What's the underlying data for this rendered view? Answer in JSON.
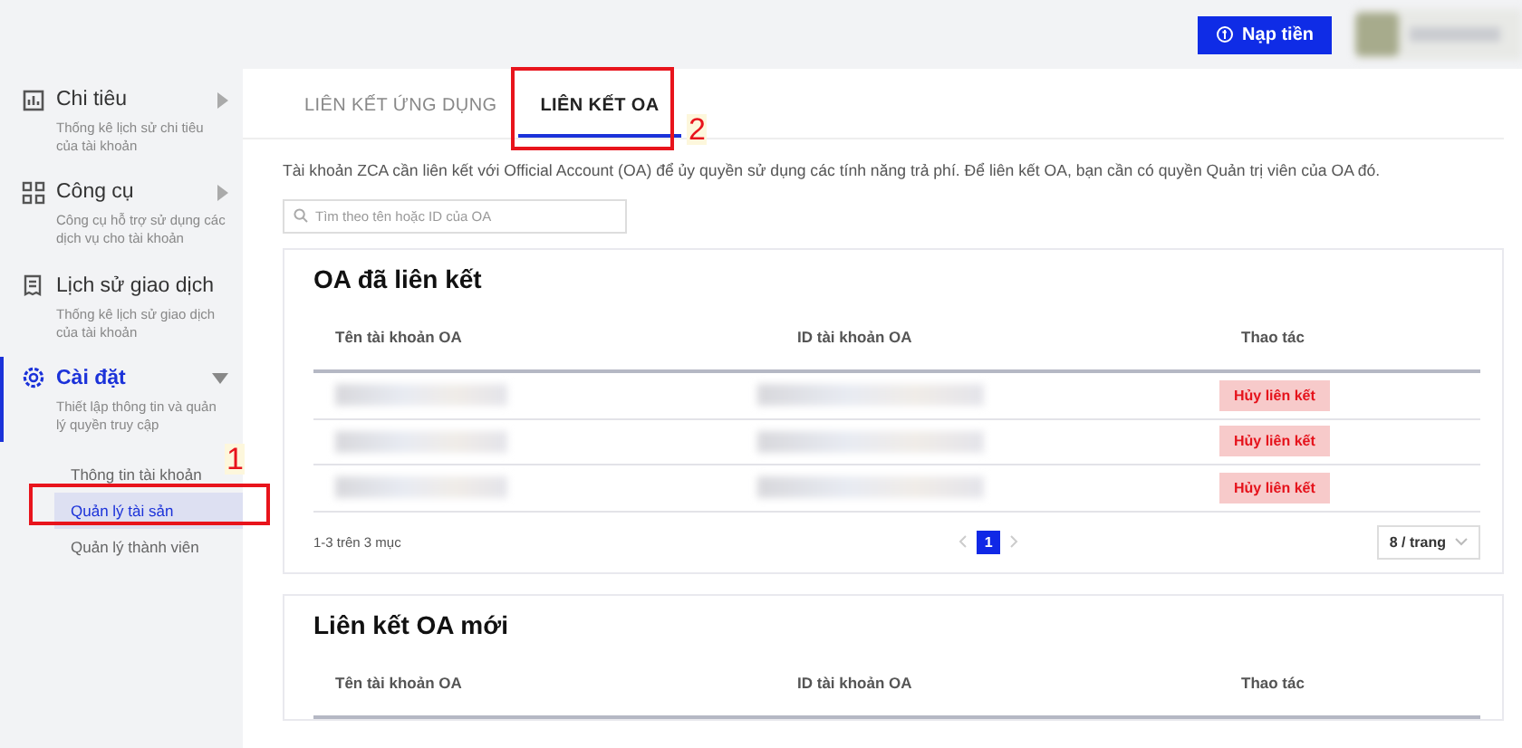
{
  "header": {
    "topup_button": "Nạp tiền"
  },
  "sidebar": {
    "items": [
      {
        "kind": "chart",
        "title": "Chi tiêu",
        "subtitle": "Thống kê lịch sử chi tiêu của tài khoản",
        "expanded": false,
        "selected": false
      },
      {
        "kind": "tools",
        "title": "Công cụ",
        "subtitle": "Công cụ hỗ trợ sử dụng các dịch vụ cho tài khoản",
        "expanded": false,
        "selected": false
      },
      {
        "kind": "history",
        "title": "Lịch sử giao dịch",
        "subtitle": "Thống kê lịch sử giao dịch của tài khoản",
        "selected": false
      },
      {
        "kind": "settings",
        "title": "Cài đặt",
        "subtitle": "Thiết lập thông tin và quản lý quyền truy cập",
        "expanded": true,
        "selected": true,
        "children": [
          {
            "label": "Thông tin tài khoản",
            "selected": false
          },
          {
            "label": "Quản lý tài sản",
            "selected": true
          },
          {
            "label": "Quản lý thành viên",
            "selected": false
          }
        ]
      }
    ]
  },
  "tabs": [
    {
      "label": "LIÊN KẾT ỨNG DỤNG",
      "selected": false
    },
    {
      "label": "LIÊN KẾT OA",
      "selected": true
    }
  ],
  "description": "Tài khoản ZCA cần liên kết với Official Account (OA) để ủy quyền sử dụng các tính năng trả phí. Để liên kết OA, bạn cần có quyền Quản trị viên của OA đó.",
  "search": {
    "placeholder": "Tìm theo tên hoặc ID của OA"
  },
  "linked_oa": {
    "title": "OA đã liên kết",
    "columns": [
      "Tên tài khoản OA",
      "ID tài khoản OA",
      "Thao tác"
    ],
    "rows": [
      {
        "action": "Hủy liên kết"
      },
      {
        "action": "Hủy liên kết"
      },
      {
        "action": "Hủy liên kết"
      }
    ],
    "summary": "1-3 trên 3 mục",
    "pages": [
      {
        "label": "1",
        "selected": true
      }
    ],
    "page_size": "8 / trang"
  },
  "new_oa": {
    "title": "Liên kết OA mới",
    "columns": [
      "Tên tài khoản OA",
      "ID tài khoản OA",
      "Thao tác"
    ]
  },
  "annotations": [
    {
      "label": "1"
    },
    {
      "label": "2"
    }
  ]
}
